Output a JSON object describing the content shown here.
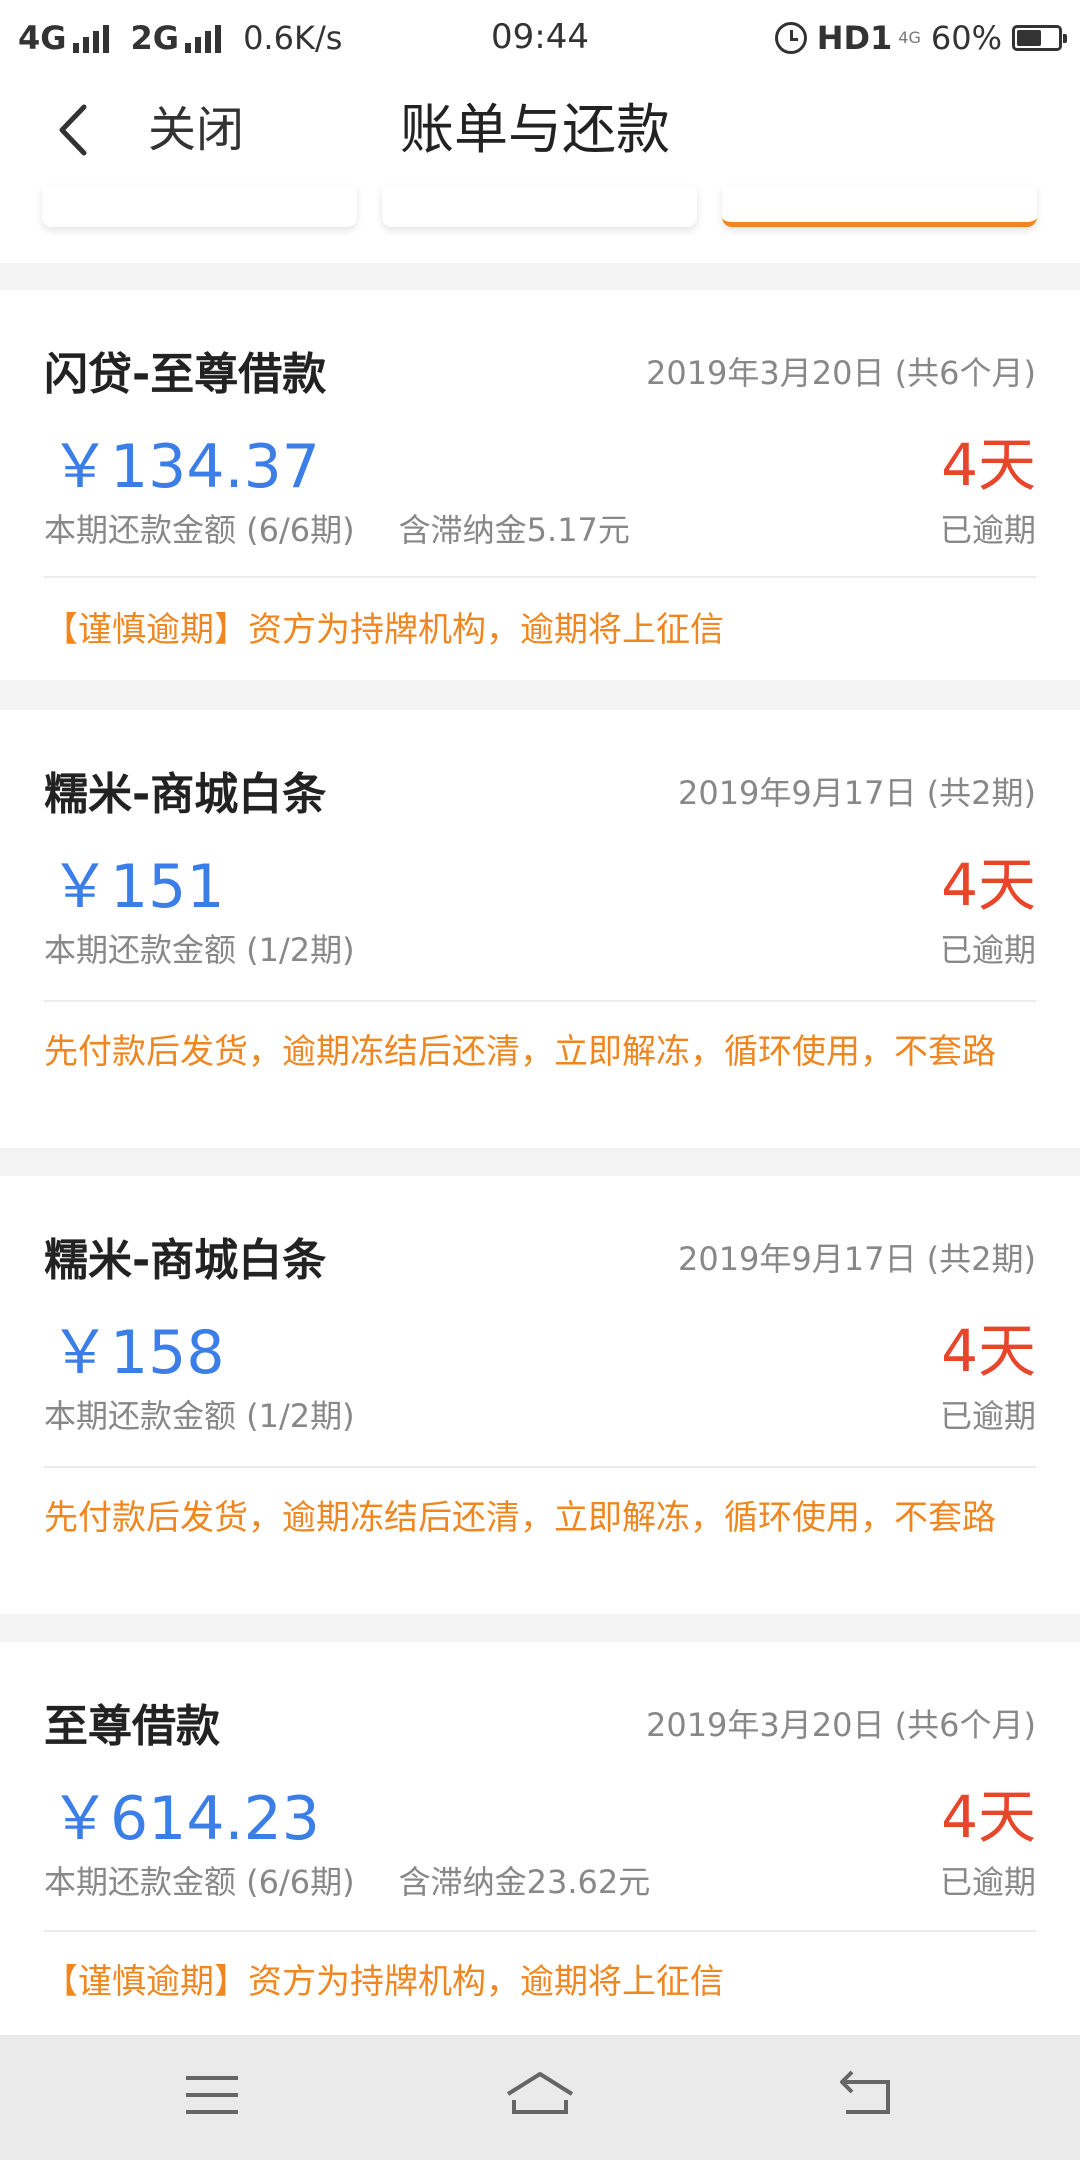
{
  "status_bar": {
    "network1": "4G",
    "network2": "2G",
    "speed": "0.6K/s",
    "time": "09:44",
    "hd": "HD1",
    "hd_sup": "4G",
    "battery": "60%",
    "battery_level": 0.6
  },
  "nav": {
    "close_label": "关闭",
    "title": "账单与还款"
  },
  "bills": [
    {
      "name": "闪贷-至尊借款",
      "date": "2019年3月20日 (共6个月)",
      "amount": "￥134.37",
      "days": "4天",
      "period_label": "本期还款金额 (6/6期)",
      "late_fee": "含滞纳金5.17元",
      "status": "已逾期",
      "note": "【谨慎逾期】资方为持牌机构，逾期将上征信"
    },
    {
      "name": "糯米-商城白条",
      "date": "2019年9月17日 (共2期)",
      "amount": "￥151",
      "days": "4天",
      "period_label": "本期还款金额 (1/2期)",
      "late_fee": "",
      "status": "已逾期",
      "note": "先付款后发货，逾期冻结后还清，立即解冻，循环使用，不套路"
    },
    {
      "name": "糯米-商城白条",
      "date": "2019年9月17日 (共2期)",
      "amount": "￥158",
      "days": "4天",
      "period_label": "本期还款金额 (1/2期)",
      "late_fee": "",
      "status": "已逾期",
      "note": "先付款后发货，逾期冻结后还清，立即解冻，循环使用，不套路"
    },
    {
      "name": "至尊借款",
      "date": "2019年3月20日 (共6个月)",
      "amount": "￥614.23",
      "days": "4天",
      "period_label": "本期还款金额 (6/6期)",
      "late_fee": "含滞纳金23.62元",
      "status": "已逾期",
      "note": "【谨慎逾期】资方为持牌机构，逾期将上征信"
    }
  ],
  "colors": {
    "accent_orange": "#f0861f",
    "amount_blue": "#3c7ee8",
    "overdue_red": "#e8462a"
  },
  "icons": {
    "back": "chevron-left-icon",
    "menu": "menu-icon",
    "home": "home-icon",
    "return": "return-icon"
  }
}
